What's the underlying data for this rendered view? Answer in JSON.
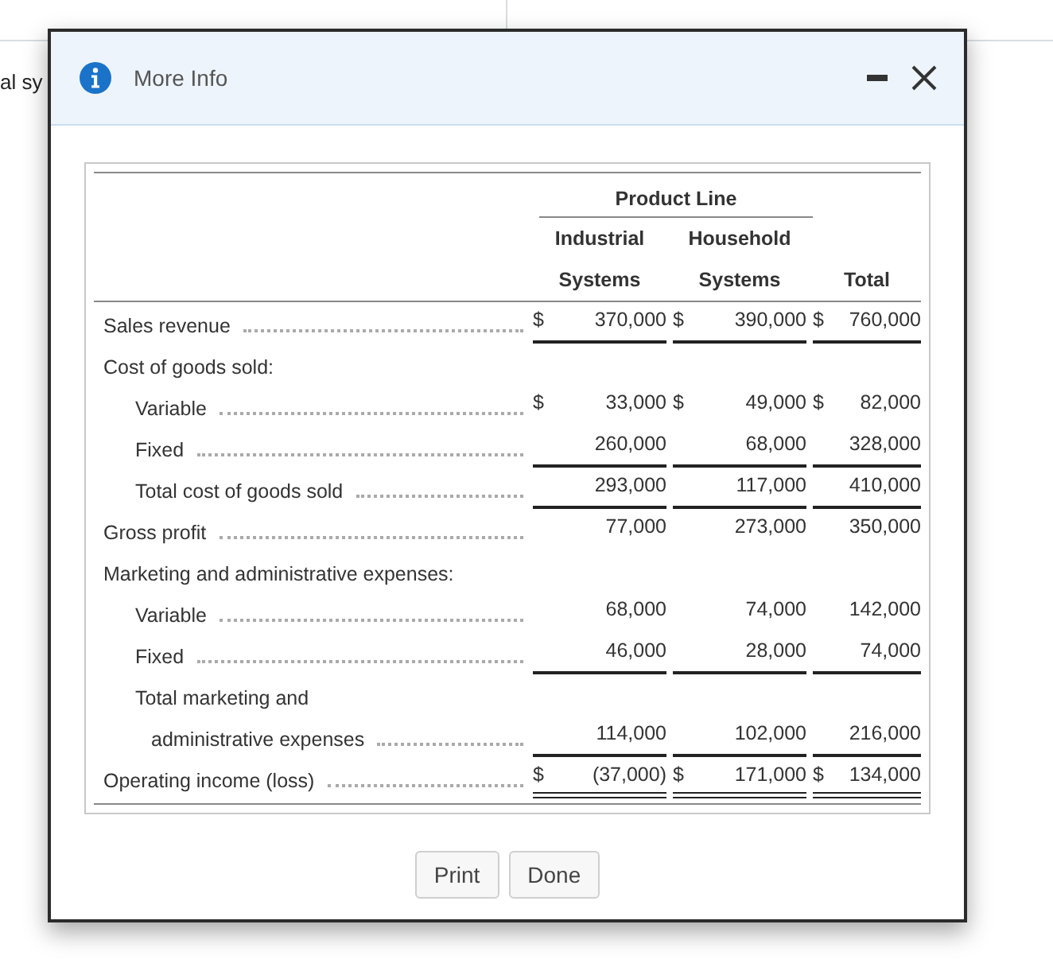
{
  "background": {
    "text": "al sy"
  },
  "dialog": {
    "title": "More Info",
    "table": {
      "group_heading": "Product Line",
      "columns": [
        {
          "lines": [
            "Industrial",
            "Systems"
          ]
        },
        {
          "lines": [
            "Household",
            "Systems"
          ]
        },
        {
          "lines": [
            "Total"
          ]
        }
      ],
      "rows": [
        {
          "kind": "line",
          "label": "Sales revenue",
          "leader": true,
          "underlined": true,
          "double_underlined": false,
          "cells": [
            {
              "currency": "$",
              "amount": "370,000"
            },
            {
              "currency": "$",
              "amount": "390,000"
            },
            {
              "currency": "$",
              "amount": "760,000"
            }
          ]
        },
        {
          "kind": "line",
          "label": "Cost of goods sold:",
          "leader": false,
          "cells": []
        },
        {
          "kind": "subline",
          "label": "Variable",
          "leader": true,
          "underlined": false,
          "double_underlined": false,
          "cells": [
            {
              "currency": "$",
              "amount": "33,000"
            },
            {
              "currency": "$",
              "amount": "49,000"
            },
            {
              "currency": "$",
              "amount": "82,000"
            }
          ]
        },
        {
          "kind": "subline",
          "label": "Fixed",
          "leader": true,
          "underlined": true,
          "double_underlined": false,
          "cells": [
            {
              "amount": "260,000"
            },
            {
              "amount": "68,000"
            },
            {
              "amount": "328,000"
            }
          ]
        },
        {
          "kind": "subline",
          "label": "Total cost of goods sold",
          "leader": true,
          "underlined": true,
          "double_underlined": false,
          "cells": [
            {
              "amount": "293,000"
            },
            {
              "amount": "117,000"
            },
            {
              "amount": "410,000"
            }
          ]
        },
        {
          "kind": "line",
          "label": "Gross profit",
          "leader": true,
          "underlined": false,
          "double_underlined": false,
          "cells": [
            {
              "amount": "77,000"
            },
            {
              "amount": "273,000"
            },
            {
              "amount": "350,000"
            }
          ]
        },
        {
          "kind": "line",
          "label": "Marketing and administrative expenses:",
          "leader": false,
          "cells": []
        },
        {
          "kind": "subline",
          "label": "Variable",
          "leader": true,
          "underlined": false,
          "double_underlined": false,
          "cells": [
            {
              "amount": "68,000"
            },
            {
              "amount": "74,000"
            },
            {
              "amount": "142,000"
            }
          ]
        },
        {
          "kind": "subline",
          "label": "Fixed",
          "leader": true,
          "underlined": true,
          "double_underlined": false,
          "cells": [
            {
              "amount": "46,000"
            },
            {
              "amount": "28,000"
            },
            {
              "amount": "74,000"
            }
          ]
        },
        {
          "kind": "subline",
          "label": "Total marketing and",
          "leader": false,
          "cells": []
        },
        {
          "kind": "continuation",
          "label": "administrative expenses",
          "leader": true,
          "underlined": true,
          "double_underlined": false,
          "cells": [
            {
              "amount": "114,000"
            },
            {
              "amount": "102,000"
            },
            {
              "amount": "216,000"
            }
          ]
        },
        {
          "kind": "line",
          "label": "Operating income (loss)",
          "leader": true,
          "underlined": false,
          "double_underlined": true,
          "cells": [
            {
              "currency": "$",
              "amount": "(37,000)"
            },
            {
              "currency": "$",
              "amount": "171,000"
            },
            {
              "currency": "$",
              "amount": "134,000"
            }
          ]
        }
      ]
    },
    "buttons": [
      "Print",
      "Done"
    ]
  }
}
